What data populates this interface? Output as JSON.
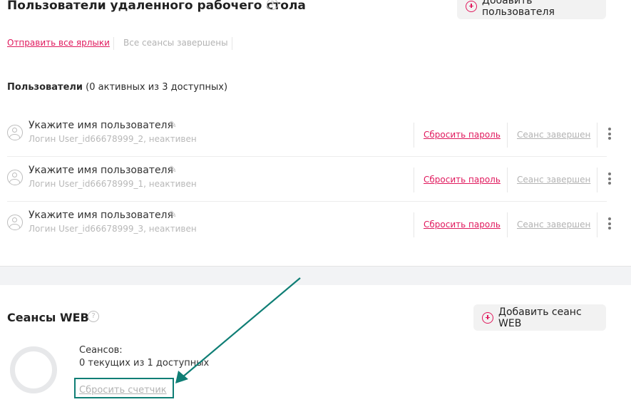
{
  "rdp": {
    "title": "Пользователи удаленного рабочего стола",
    "help_glyph": "?",
    "add_user_label": "Добавить пользователя",
    "send_shortcuts_label": "Отправить все ярлыки",
    "sessions_status": "Все сеансы завершены"
  },
  "users": {
    "heading_bold": "Пользователи",
    "heading_rest": "(0 активных из 3 доступных)",
    "items": [
      {
        "name": "Укажите имя пользователя",
        "login": "Логин User_id66678999_2, неактивен",
        "reset_password": "Сбросить пароль",
        "session_status": "Сеанс завершен"
      },
      {
        "name": "Укажите имя пользователя",
        "login": "Логин User_id66678999_1, неактивен",
        "reset_password": "Сбросить пароль",
        "session_status": "Сеанс завершен"
      },
      {
        "name": "Укажите имя пользователя",
        "login": "Логин User_id66678999_3, неактивен",
        "reset_password": "Сбросить пароль",
        "session_status": "Сеанс завершен"
      }
    ]
  },
  "web": {
    "title": "Сеансы WEB",
    "help_glyph": "?",
    "add_session_label": "Добавить сеанс WEB",
    "sessions_label": "Сеансов:",
    "sessions_count": "0 текущих из 1 доступных",
    "reset_counter_label": "Сбросить счетчик"
  },
  "icons": {
    "pencil": "✎",
    "plus": "plus-circle-icon",
    "avatar": "user-circle-icon",
    "kebab": "kebab-menu-icon"
  },
  "colors": {
    "accent": "#e0195d",
    "highlight": "#0f7e75",
    "muted": "#b3b3b3"
  }
}
